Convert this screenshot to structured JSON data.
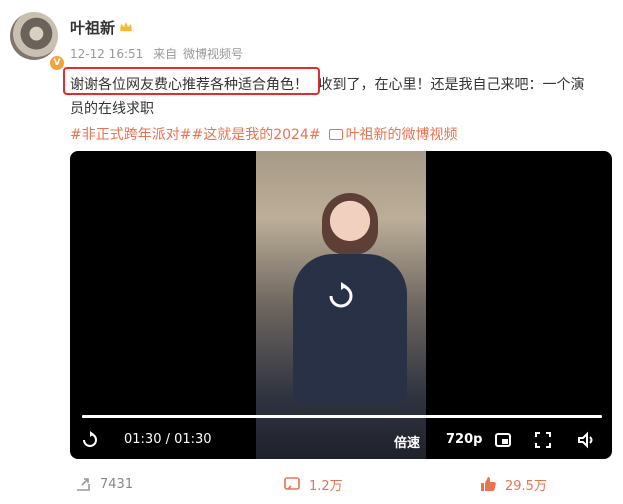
{
  "user": {
    "name": "叶祖新",
    "verified": "V"
  },
  "meta": {
    "time": "12-12 16:51",
    "source_prefix": "来自",
    "source": "微博视频号"
  },
  "content": {
    "highlighted": "谢谢各位网友费心推荐各种适合角色！",
    "line1_rest": "收到了，在心里！还是我自己来吧：一个演",
    "line2": "员的在线求职"
  },
  "topics": {
    "tag1": "#非正式跨年派对#",
    "tag2": "#这就是我的2024#",
    "video_link": "叶祖新的微博视频"
  },
  "video": {
    "time": "01:30 / 01:30",
    "speed": "倍速",
    "quality": "720p",
    "progress": 1.0
  },
  "footer": {
    "share": "7431",
    "comments": "1.2万",
    "likes": "29.5万"
  },
  "colors": {
    "accent": "#eb7350",
    "highlight_border": "#e62b2b"
  }
}
